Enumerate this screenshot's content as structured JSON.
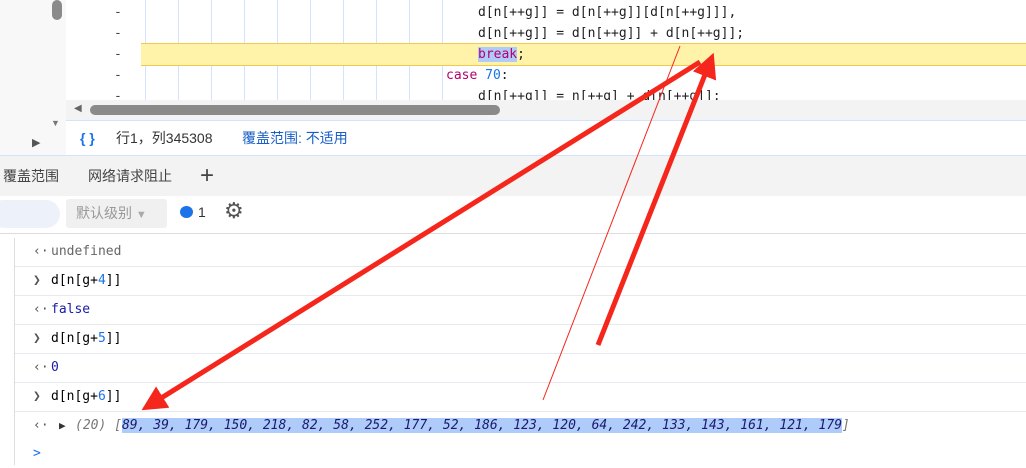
{
  "editor": {
    "lines": [
      {
        "code": "d[n[++g]] = d[n[++g]][d[n[++g]]],"
      },
      {
        "code": "d[n[++g]] = d[n[++g]] + d[n[++g]];"
      },
      {
        "keyword": "break",
        "rest": ";"
      },
      {
        "keyword": "case",
        "number": "70",
        "rest": ":"
      },
      {
        "code": "d[n[++g]] = n[++g] + d[n[++g]];"
      }
    ],
    "dash": "-"
  },
  "status": {
    "braces": "{ }",
    "position": "行1，列345308",
    "coverage": "覆盖范围: 不适用"
  },
  "drawer_tabs": [
    "覆盖范围",
    "网络请求阻止"
  ],
  "add_tab": "+",
  "toolbar": {
    "level": "默认级别",
    "issues_count": "1"
  },
  "console": [
    {
      "type": "out",
      "text": "undefined"
    },
    {
      "type": "in",
      "pre": "d[n[g+",
      "num": "4",
      "post": "]]"
    },
    {
      "type": "out",
      "text": "false"
    },
    {
      "type": "in",
      "pre": "d[n[g+",
      "num": "5",
      "post": "]]"
    },
    {
      "type": "out",
      "text": "0"
    },
    {
      "type": "in",
      "pre": "d[n[g+",
      "num": "6",
      "post": "]]"
    }
  ],
  "result": {
    "count": "(20)",
    "open": "[",
    "values": "89, 39, 179, 150, 218, 82, 58, 252, 177, 52, 186, 123, 120, 64, 242, 133, 143, 161, 121, 179",
    "close": "]"
  },
  "prompt": ">"
}
